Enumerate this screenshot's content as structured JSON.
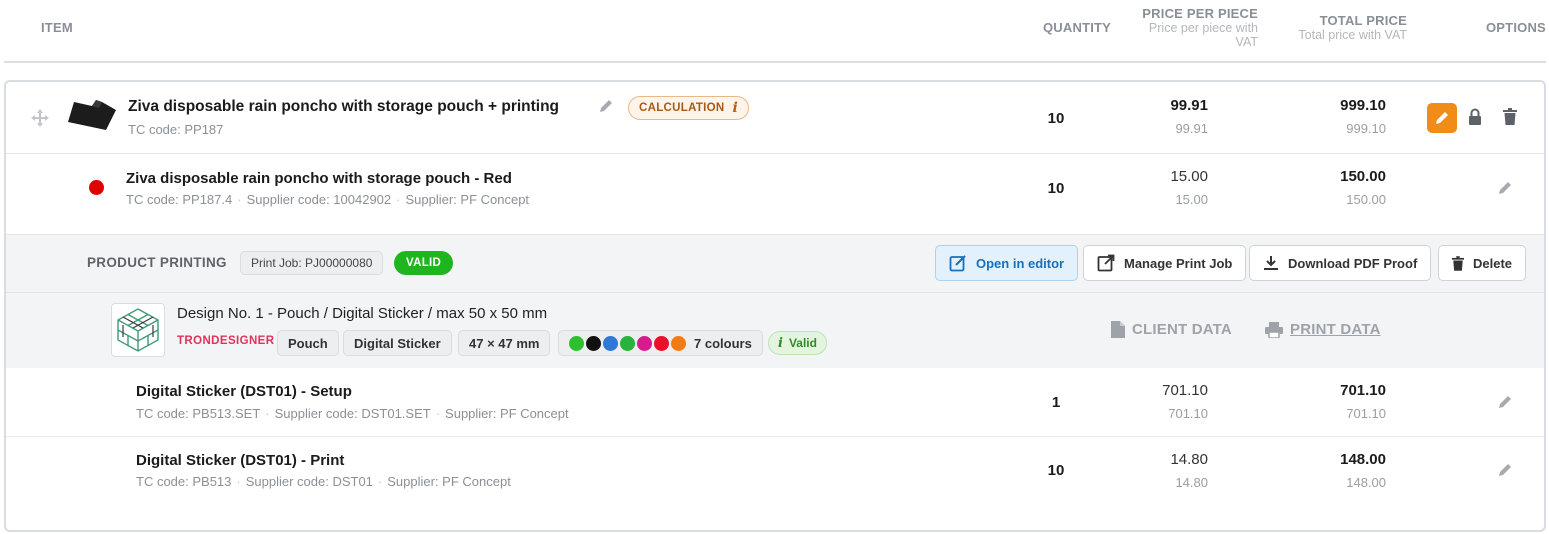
{
  "header": {
    "item": "ITEM",
    "quantity": "QUANTITY",
    "price_per_piece": "PRICE PER PIECE",
    "price_per_piece_sub_line1": "Price per piece with",
    "price_per_piece_sub_line2": "VAT",
    "total_price": "TOTAL PRICE",
    "total_price_sub": "Total price with VAT",
    "options": "OPTIONS"
  },
  "product": {
    "name": "Ziva disposable rain poncho with storage pouch + printing",
    "tc_code": "TC code: PP187",
    "badge": "CALCULATION",
    "badge_info": "i",
    "quantity": "10",
    "price": "99.91",
    "price_vat": "99.91",
    "total": "999.10",
    "total_vat": "999.10"
  },
  "variant": {
    "name": "Ziva disposable rain poncho with storage pouch - Red",
    "color": "#e00000",
    "tc_code": "TC code: PP187.4",
    "supplier_code": "Supplier code: 10042902",
    "supplier": "Supplier: PF Concept",
    "separator": "·",
    "quantity": "10",
    "price": "15.00",
    "price_vat": "15.00",
    "total": "150.00",
    "total_vat": "150.00"
  },
  "printing": {
    "label": "PRODUCT PRINTING",
    "job": "Print Job: PJ00000080",
    "status": "VALID",
    "buttons": {
      "open_editor": "Open in editor",
      "manage": "Manage Print Job",
      "download": "Download PDF Proof",
      "delete": "Delete"
    }
  },
  "design": {
    "title": "Design No. 1 - Pouch / Digital Sticker / max 50 x 50 mm",
    "brand": "TRONDESIGNER",
    "chips": [
      "Pouch",
      "Digital Sticker",
      "47 × 47 mm"
    ],
    "colours_label": "7 colours",
    "colours": [
      "#2ebf2e",
      "#111111",
      "#2f78d8",
      "#27b33c",
      "#d81b8c",
      "#e8102a",
      "#f47a12"
    ],
    "valid_label": "Valid",
    "valid_info": "i",
    "client_data": "CLIENT DATA",
    "print_data": "PRINT DATA"
  },
  "services": [
    {
      "name": "Digital Sticker (DST01) - Setup",
      "tc_code": "TC code: PB513.SET",
      "supplier_code": "Supplier code: DST01.SET",
      "supplier": "Supplier: PF Concept",
      "quantity": "1",
      "price": "701.10",
      "price_vat": "701.10",
      "total": "701.10",
      "total_vat": "701.10"
    },
    {
      "name": "Digital Sticker (DST01) - Print",
      "tc_code": "TC code: PB513",
      "supplier_code": "Supplier code: DST01",
      "supplier": "Supplier: PF Concept",
      "quantity": "10",
      "price": "14.80",
      "price_vat": "14.80",
      "total": "148.00",
      "total_vat": "148.00"
    }
  ],
  "colors": {
    "accent_orange": "#f28c18",
    "valid_green": "#1fb51f",
    "brand_pink": "#e2325b",
    "editor_blue": "#1a6fb8"
  }
}
